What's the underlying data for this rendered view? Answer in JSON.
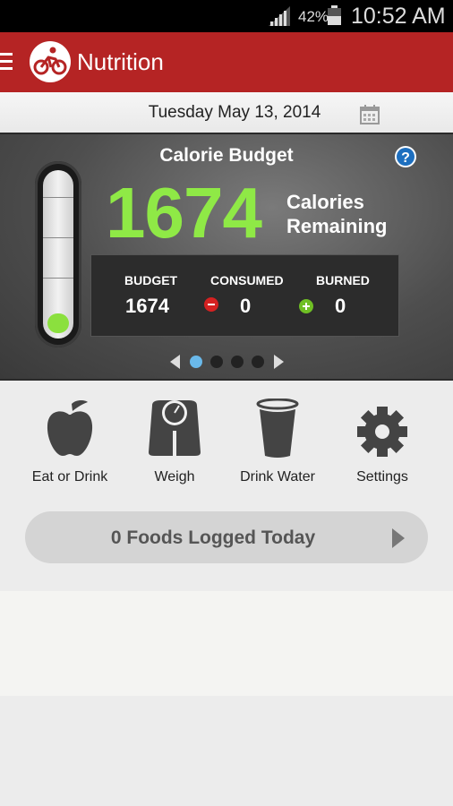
{
  "status_bar": {
    "battery_percent": "42%",
    "time": "10:52 AM",
    "signal_icon": "signal-bars-icon",
    "battery_icon": "battery-icon"
  },
  "app_bar": {
    "title": "Nutrition",
    "menu_icon": "hamburger-menu-icon",
    "logo_icon": "cyclist-logo-icon",
    "color": "#b52424"
  },
  "date_row": {
    "date": "Tuesday May 13, 2014",
    "calendar_icon": "calendar-icon"
  },
  "calorie_panel": {
    "title": "Calorie Budget",
    "remaining_value": "1674",
    "remaining_label_line1": "Calories",
    "remaining_label_line2": "Remaining",
    "help_icon": "help-question-icon",
    "thermometer_fill_fraction": 0.08,
    "stats": {
      "budget_label": "BUDGET",
      "budget_value": "1674",
      "consumed_label": "CONSUMED",
      "consumed_value": "0",
      "burned_label": "BURNED",
      "burned_value": "0"
    },
    "pager": {
      "pages": 4,
      "active_page": 1
    },
    "accent_color": "#8fe946"
  },
  "actions": [
    {
      "label": "Eat or Drink",
      "icon": "apple-icon"
    },
    {
      "label": "Weigh",
      "icon": "scale-icon"
    },
    {
      "label": "Drink Water",
      "icon": "water-glass-icon"
    },
    {
      "label": "Settings",
      "icon": "gear-icon"
    }
  ],
  "foods_logged": {
    "text": "0 Foods Logged Today",
    "arrow_icon": "chevron-right-icon"
  }
}
